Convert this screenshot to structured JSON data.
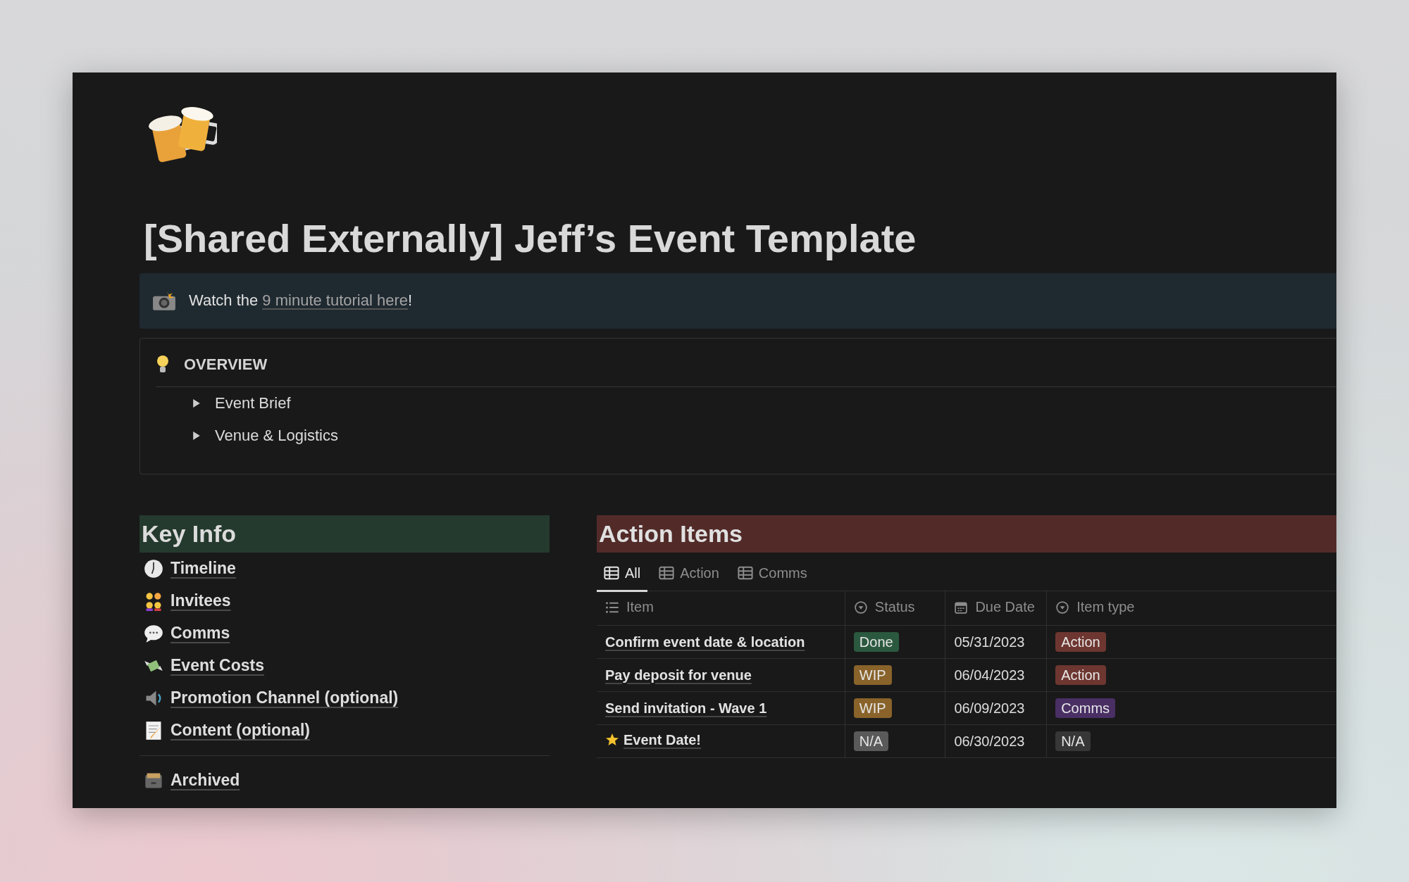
{
  "page": {
    "title": "[Shared Externally] Jeff’s Event Template"
  },
  "callout": {
    "text_before": "Watch the ",
    "link": "9 minute tutorial here",
    "text_after": "!"
  },
  "overview": {
    "heading": "OVERVIEW",
    "toggles": [
      {
        "label": "Event Brief",
        "expanded": false
      },
      {
        "label": "Venue & Logistics",
        "expanded": false
      }
    ]
  },
  "key_info": {
    "heading": "Key Info",
    "links": [
      "Timeline",
      "Invitees",
      "Comms",
      "Event Costs",
      "Promotion Channel (optional)",
      "Content (optional)"
    ],
    "archived": "Archived"
  },
  "action_items": {
    "heading": "Action Items",
    "tabs": [
      {
        "label": "All",
        "selected": true
      },
      {
        "label": "Action",
        "selected": false
      },
      {
        "label": "Comms",
        "selected": false
      }
    ],
    "columns": [
      "Item",
      "Status",
      "Due Date",
      "Item type"
    ],
    "rows": [
      {
        "item": "Confirm event date & location",
        "status": {
          "label": "Done",
          "color": "#2b593f"
        },
        "due": "05/31/2023",
        "type": {
          "label": "Action",
          "color": "#6e3630"
        }
      },
      {
        "item": "Pay deposit for venue",
        "status": {
          "label": "WIP",
          "color": "#89632a"
        },
        "due": "06/04/2023",
        "type": {
          "label": "Action",
          "color": "#6e3630"
        }
      },
      {
        "item": "Send invitation - Wave 1",
        "status": {
          "label": "WIP",
          "color": "#89632a"
        },
        "due": "06/09/2023",
        "type": {
          "label": "Comms",
          "color": "#492f64"
        }
      },
      {
        "item": "Event Date!",
        "status": {
          "label": "N/A",
          "color": "#5a5a5a"
        },
        "due": "06/30/2023",
        "type": {
          "label": "N/A",
          "color": "#373737"
        }
      }
    ]
  }
}
